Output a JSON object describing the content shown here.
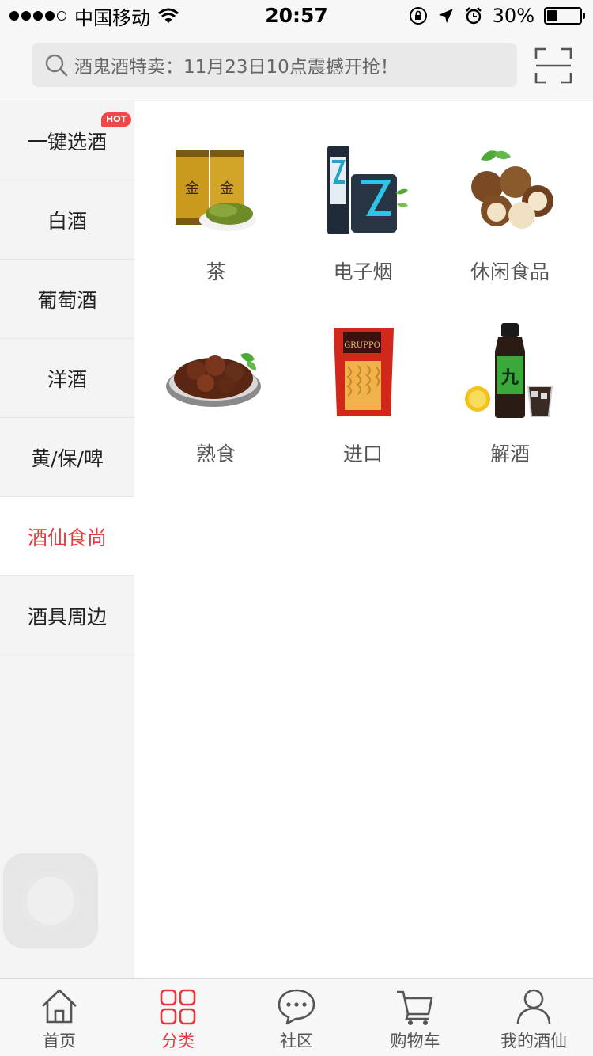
{
  "status_bar": {
    "carrier": "中国移动",
    "time": "20:57",
    "battery_text": "30%",
    "battery_level": 0.3
  },
  "search": {
    "placeholder": "酒鬼酒特卖：11月23日10点震撼开抢！"
  },
  "sidebar": {
    "badge": "HOT",
    "items": [
      {
        "label": "一键选酒"
      },
      {
        "label": "白酒"
      },
      {
        "label": "葡萄酒"
      },
      {
        "label": "洋酒"
      },
      {
        "label": "黄/保/啤"
      },
      {
        "label": "酒仙食尚"
      },
      {
        "label": "酒具周边"
      }
    ],
    "active_index": 5
  },
  "categories": [
    {
      "label": "茶",
      "icon": "tea-tins-icon"
    },
    {
      "label": "电子烟",
      "icon": "e-cigarette-icon"
    },
    {
      "label": "休闲食品",
      "icon": "macadamia-nuts-icon"
    },
    {
      "label": "熟食",
      "icon": "braised-meat-icon"
    },
    {
      "label": "进口",
      "icon": "pasta-bag-icon"
    },
    {
      "label": "解酒",
      "icon": "hangover-drink-icon"
    }
  ],
  "tab_bar": {
    "items": [
      {
        "label": "首页",
        "icon": "home-icon"
      },
      {
        "label": "分类",
        "icon": "category-grid-icon"
      },
      {
        "label": "社区",
        "icon": "chat-bubble-icon"
      },
      {
        "label": "购物车",
        "icon": "cart-icon"
      },
      {
        "label": "我的酒仙",
        "icon": "user-icon"
      }
    ],
    "active_index": 1
  },
  "colors": {
    "accent": "#e8383d",
    "sidebar_bg": "#f4f4f4",
    "bar_bg": "#f7f7f7"
  }
}
